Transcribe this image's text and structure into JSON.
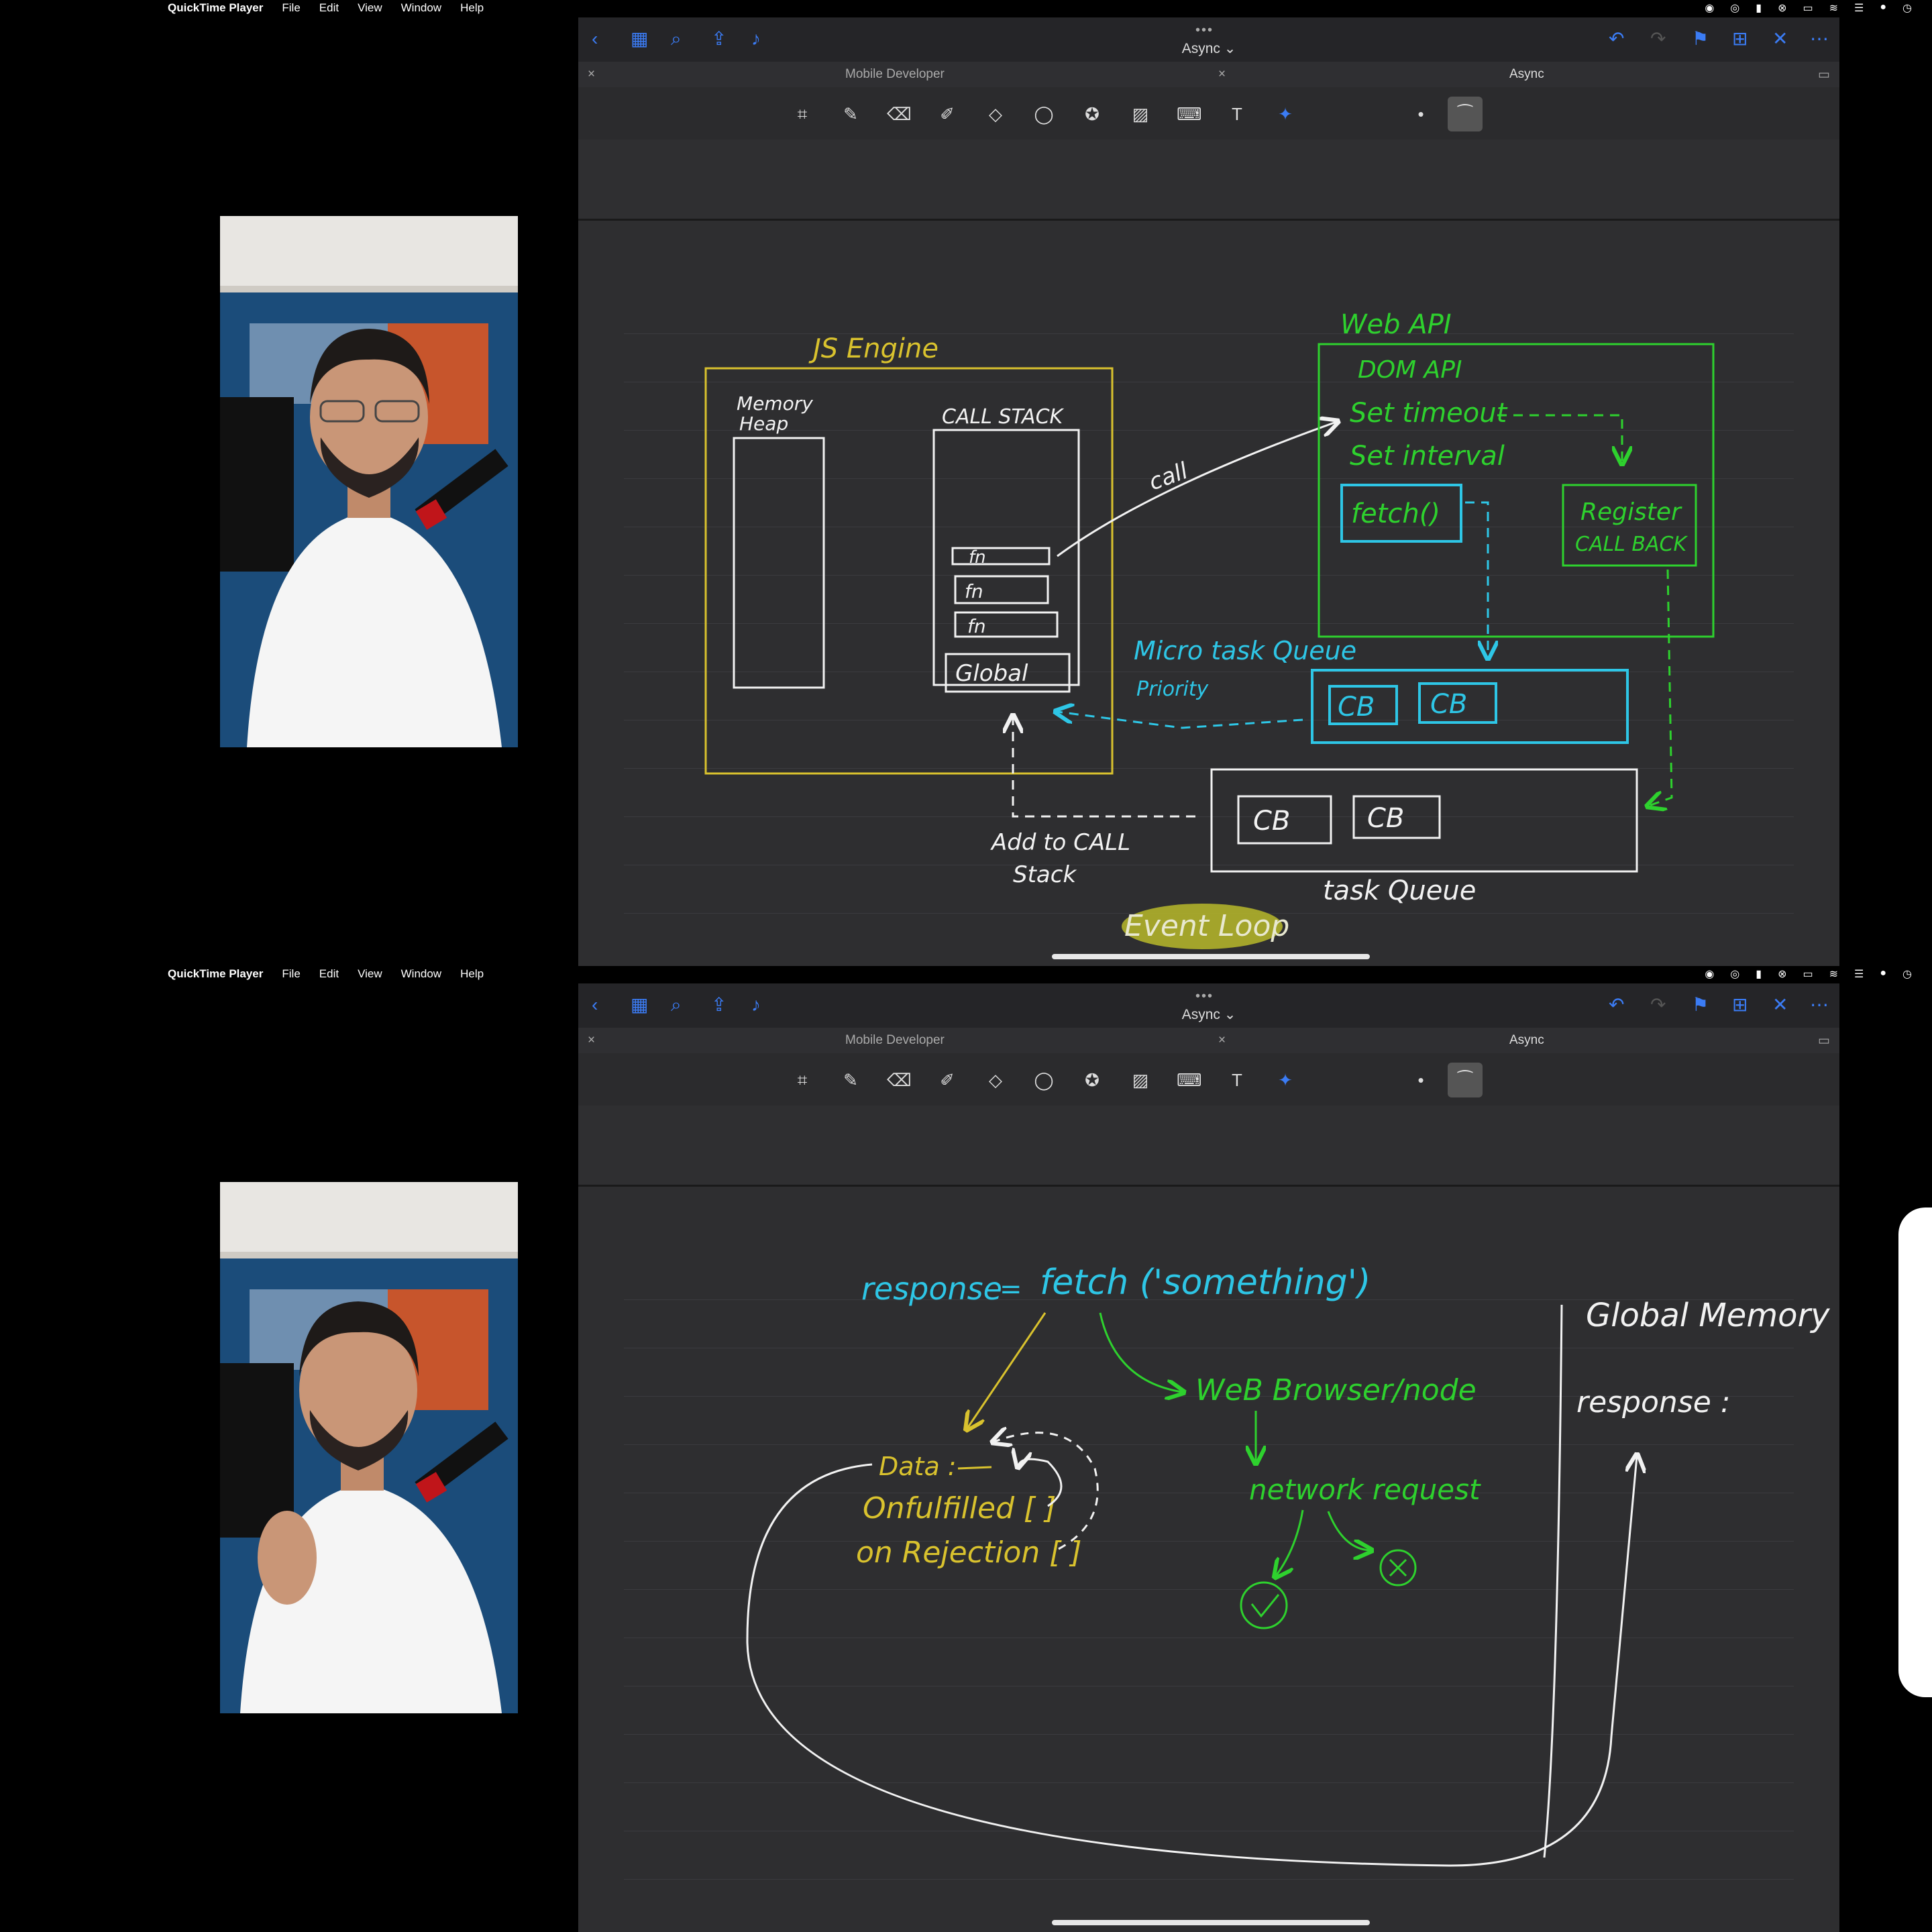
{
  "menubar": {
    "app_name": "QuickTime Player",
    "menus": [
      "File",
      "Edit",
      "View",
      "Window",
      "Help"
    ]
  },
  "app": {
    "document_title": "Async",
    "tabs": [
      "Mobile Developer",
      "Async"
    ],
    "tab_close_glyph": "×",
    "accent_color": "#3b7cf5"
  },
  "icons": {
    "titlebar_left": [
      "back-icon",
      "grid-icon",
      "search-icon",
      "share-icon",
      "microphone-icon"
    ],
    "titlebar_right": [
      "undo-icon",
      "redo-icon",
      "bookmark-icon",
      "add-page-icon",
      "close-icon",
      "more-icon"
    ],
    "tools": [
      "scan-icon",
      "pen-icon",
      "eraser-icon",
      "highlighter-icon",
      "shapes-icon",
      "lasso-icon",
      "sticker-icon",
      "image-icon",
      "keyboard-icon",
      "text-icon",
      "laser-icon"
    ]
  },
  "slide1": {
    "js_engine": "JS Engine",
    "memory_heap": [
      "Memory",
      "Heap"
    ],
    "call_stack": "CALL STACK",
    "frames": [
      "fn",
      "fn",
      "fn"
    ],
    "global": "Global",
    "call": "call",
    "web_api": "Web API",
    "dom_api": "DOM API",
    "set_timeout": "Set timeout",
    "set_interval": "Set interval",
    "fetch": "fetch()",
    "register": [
      "Register",
      "CALL BACK"
    ],
    "microtask": "Micro task Queue",
    "priority": "Priority",
    "cb": "CB",
    "add_to_call": [
      "Add to CALL",
      "Stack"
    ],
    "task_queue": "task Queue",
    "event_loop": "Event Loop"
  },
  "slide2": {
    "response": "response",
    "equals": "=",
    "fetch_call": "fetch ('something')",
    "web_browser": "WeB Browser/node",
    "network_request": "network request",
    "data": "Data :",
    "onfulfilled": "Onfulfilled [ ]",
    "onrejection": "on Rejection [ ]",
    "global_memory": "Global Memory",
    "response_label": "response :"
  },
  "colors": {
    "yellow": "#d9c22e",
    "green": "#2ed12e",
    "cyan": "#2ec6e6",
    "white": "#f2f2f2",
    "highlight": "#b7b82a"
  }
}
